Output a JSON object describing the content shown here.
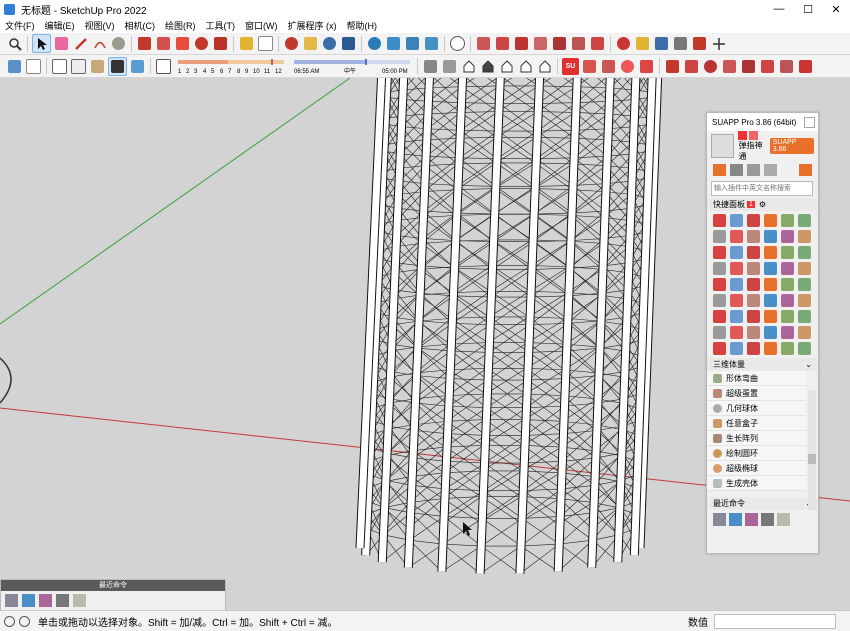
{
  "window": {
    "title": "无标题 - SketchUp Pro 2022",
    "minimize_glyph": "—",
    "maximize_glyph": "☐",
    "close_glyph": "✕"
  },
  "menu": [
    "文件(F)",
    "编辑(E)",
    "视图(V)",
    "相机(C)",
    "绘图(R)",
    "工具(T)",
    "窗口(W)",
    "扩展程序 (x)",
    "帮助(H)"
  ],
  "toolbar1_icons": [
    "zoom",
    "select",
    "eraser",
    "pencil",
    "arc",
    "circle-shape",
    "push-pull",
    "follow-me",
    "move",
    "rotate",
    "scale",
    "tape-measure",
    "text",
    "orbit",
    "pan",
    "zoom-tool",
    "zoom-extents",
    "soap-skin",
    "sandbox-a",
    "sandbox-b",
    "sandbox-c",
    "user-account",
    "warehouse",
    "extension-warehouse",
    "layout",
    "style-builder",
    "component",
    "group",
    "solid-tools",
    "intersect",
    "trim",
    "split",
    "outer-shell",
    "section-plane",
    "move-arrows"
  ],
  "toolbar2_icons": [
    "xray",
    "back-edges",
    "wireframe",
    "hidden-line",
    "shaded",
    "shaded-texture",
    "monochrome"
  ],
  "shadow_scale": {
    "ticks": [
      "1",
      "2",
      "3",
      "4",
      "5",
      "6",
      "7",
      "8",
      "9",
      "10",
      "11",
      "12"
    ],
    "time_start": "06:55 AM",
    "noon": "中午",
    "time_end": "05:00 PM"
  },
  "toolbar2_right_icons": [
    "iso-view",
    "top-view",
    "home",
    "front-view",
    "right-view",
    "back-view",
    "left-view",
    "suapp",
    "layer-a",
    "layer-b",
    "layer-c",
    "layer-d",
    "toggle-a",
    "toggle-b",
    "toggle-c",
    "toggle-d",
    "toggle-e",
    "toggle-f",
    "toggle-g",
    "toggle-h",
    "toggle-i",
    "toggle-j"
  ],
  "suapp_panel": {
    "title": "SUAPP Pro 3.86 (64bit)",
    "user_label": "弹指神通",
    "badge": "SUAPP 3.86",
    "search_placeholder": "输入插件中英文名称搜索",
    "quick_panel_label": "快捷面板",
    "quick_panel_count": "1",
    "category_label": "三维体量",
    "recent_label": "最近命令",
    "plugins": [
      {
        "name": "形体弯曲"
      },
      {
        "name": "超级蛋置"
      },
      {
        "name": "几何球体"
      },
      {
        "name": "任意盒子"
      },
      {
        "name": "生长阵列"
      },
      {
        "name": "绘制圆环"
      },
      {
        "name": "超级椭球"
      },
      {
        "name": "生成壳体"
      }
    ]
  },
  "recent_float": {
    "title": "最近命令"
  },
  "status": {
    "message": "单击或拖动以选择对象。Shift = 加/减。Ctrl = 加。Shift + Ctrl = 减。",
    "value_label": "数值",
    "value": ""
  },
  "colors": {
    "viewport_bg": "#d3d3d3",
    "accent": "#2f7fd8",
    "suapp_orange": "#e8702a",
    "green_axis": "#3aa13a",
    "red_axis": "#c23a3a"
  }
}
